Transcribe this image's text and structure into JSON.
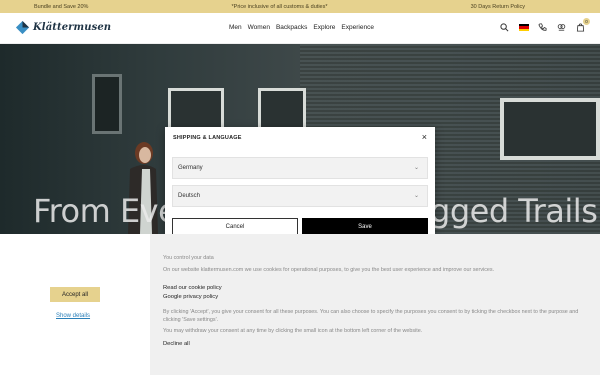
{
  "promo": {
    "left": "Bundle and Save 20%",
    "center": "*Price inclusive of all customs & duties*",
    "right": "30 Days Return Policy"
  },
  "header": {
    "brand": "Klättermusen",
    "nav": [
      "Men",
      "Women",
      "Backpacks",
      "Explore",
      "Experience"
    ],
    "cart_count": "0"
  },
  "hero": {
    "headline_left": "From Ever",
    "headline_right": "gged Trails"
  },
  "modal": {
    "title": "SHIPPING & LANGUAGE",
    "country": "Germany",
    "language": "Deutsch",
    "cancel_label": "Cancel",
    "save_label": "Save"
  },
  "cookie": {
    "accept_label": "Accept all",
    "show_details_label": "Show details",
    "heading": "You control your data",
    "intro": "On our website klattermusen.com we use cookies for operational purposes, to give you the best user experience and improve our services.",
    "link_policy": "Read our cookie policy",
    "link_privacy": "Google privacy policy",
    "consent_text": "By clicking 'Accept', you give your consent for all these purposes. You can also choose to specify the purposes you consent to by ticking the checkbox next to the purpose and clicking 'Save settings'.",
    "withdraw_text": "You may withdraw your consent at any time by clicking the small icon at the bottom left corner of the website.",
    "decline_label": "Decline all"
  }
}
